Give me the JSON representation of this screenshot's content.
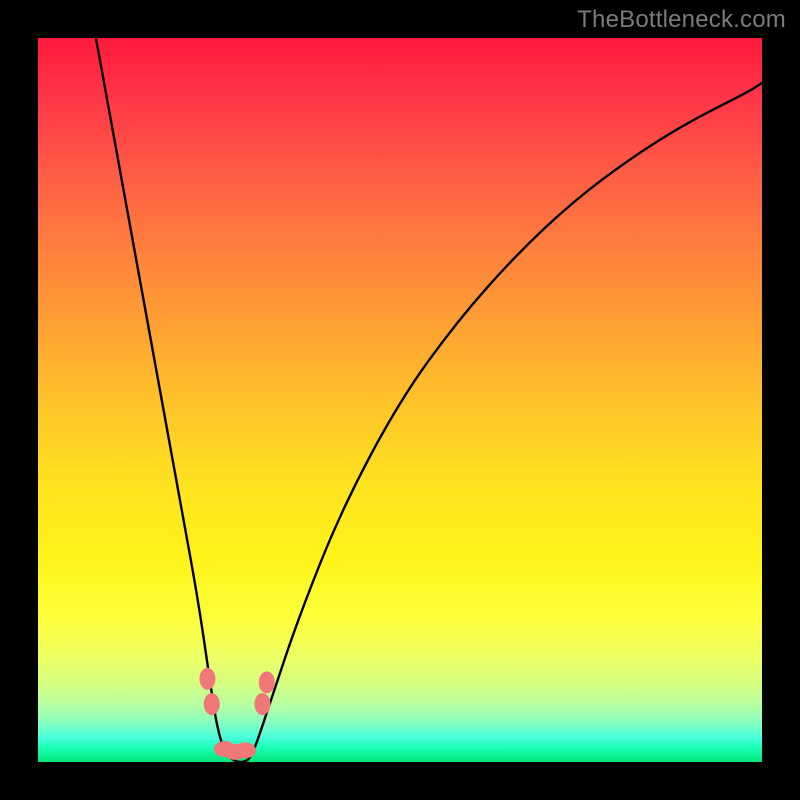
{
  "watermark": "TheBottleneck.com",
  "chart_data": {
    "type": "line",
    "title": "",
    "xlabel": "",
    "ylabel": "",
    "xlim": [
      0,
      100
    ],
    "ylim": [
      0,
      100
    ],
    "series": [
      {
        "name": "bottleneck-curve",
        "x": [
          8,
          10,
          12,
          14,
          16,
          18,
          20,
          22,
          23.5,
          24.5,
          25.5,
          27,
          29,
          30,
          32,
          36,
          42,
          50,
          58,
          66,
          74,
          82,
          90,
          98,
          100
        ],
        "y": [
          100,
          89,
          78,
          67,
          56,
          45,
          34,
          23,
          13,
          6,
          2,
          0,
          0,
          2,
          8,
          20,
          35,
          50,
          61,
          70,
          77.5,
          83.5,
          88.5,
          92.5,
          93.8
        ]
      }
    ],
    "markers": [
      {
        "name": "left-notch-upper",
        "x": 23.4,
        "y": 11.5
      },
      {
        "name": "left-notch-lower",
        "x": 24.0,
        "y": 8.0
      },
      {
        "name": "right-notch-upper",
        "x": 31.6,
        "y": 11.0
      },
      {
        "name": "right-notch-lower",
        "x": 31.0,
        "y": 8.0
      },
      {
        "name": "bottom-blob-1",
        "x": 25.8,
        "y": 1.8
      },
      {
        "name": "bottom-blob-2",
        "x": 27.2,
        "y": 1.4
      },
      {
        "name": "bottom-blob-3",
        "x": 28.6,
        "y": 1.6
      }
    ],
    "gradient_stops": [
      {
        "pos": 0,
        "color": "#ff1a3c"
      },
      {
        "pos": 0.5,
        "color": "#ffc828"
      },
      {
        "pos": 0.85,
        "color": "#f0ff60"
      },
      {
        "pos": 1.0,
        "color": "#00e676"
      }
    ]
  }
}
